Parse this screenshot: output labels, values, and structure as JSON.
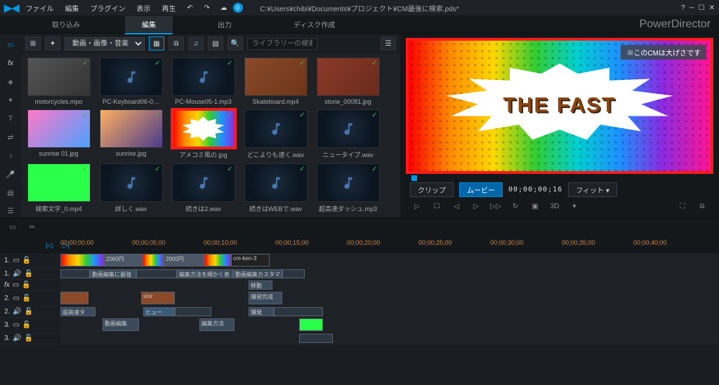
{
  "app": {
    "titlePath": "C:¥Users¥chibi¥Documents¥プロジェクト¥CM最後に検索.pds*",
    "brand": "PowerDirector"
  },
  "menu": {
    "file": "ファイル",
    "edit": "編集",
    "plugin": "プラグイン",
    "view": "表示",
    "play": "再生",
    "badge": "0"
  },
  "tabs": {
    "import": "取り込み",
    "edit": "編集",
    "output": "出力",
    "disc": "ディスク作成"
  },
  "mediaBar": {
    "filter": "動画・画像・音楽",
    "searchPlaceholder": "ライブラリーの検索"
  },
  "media": [
    {
      "label": "motorcycles.mpo",
      "kind": "img",
      "grad": "#555,#333"
    },
    {
      "label": "PC-Keyboard06-0…",
      "kind": "aud"
    },
    {
      "label": "PC-Mouse05-1.mp3",
      "kind": "aud"
    },
    {
      "label": "Skateboard.mp4",
      "kind": "vid",
      "grad": "#8b4a2a,#6a3518"
    },
    {
      "label": "stone_00081.jpg",
      "kind": "img",
      "grad": "#8a3a2a,#6a2a1a"
    },
    {
      "label": "sunrise 01.jpg",
      "kind": "img",
      "grad": "#ff7ac8,#4aa0ff"
    },
    {
      "label": "sunrise.jpg",
      "kind": "img",
      "grad": "#ffb060,#4a3a8a"
    },
    {
      "label": "アメコミ風の.jpg",
      "kind": "burst",
      "highlight": true
    },
    {
      "label": "どこよりも速く.wav",
      "kind": "aud"
    },
    {
      "label": "ニュータイプ.wav",
      "kind": "aud"
    },
    {
      "label": "検索文字_0.mp4",
      "kind": "vid",
      "grad": "#2aff4a,#2aff4a"
    },
    {
      "label": "詳しく.wav",
      "kind": "aud"
    },
    {
      "label": "続きは2.wav",
      "kind": "aud"
    },
    {
      "label": "続きはWEBで.wav",
      "kind": "aud"
    },
    {
      "label": "超高速ダッシュ.mp3",
      "kind": "aud"
    }
  ],
  "preview": {
    "noticeText": "※このCMは大げさです",
    "burstText": "THE FAST",
    "clip": "クリップ",
    "movie": "ムービー",
    "timecode": "00;00;00;16",
    "fit": "フィット",
    "threeD": "3D"
  },
  "ruler": [
    "00;00;00;00",
    "00;00;05;00",
    "00;00;10;00",
    "00;00;15;00",
    "00;00;20;00",
    "00;00;25;00",
    "00;00;30;00",
    "00;00;35;00",
    "00;00;40;00"
  ],
  "tracks": {
    "t1": "1.",
    "t2": "1.",
    "fx": "fx",
    "t3": "2.",
    "t4": "2.",
    "t5": "3.",
    "t6": "3."
  },
  "clips": {
    "c1": "2000円",
    "c2": "2000円",
    "c3": "cm-ken-3",
    "c4": "動画編集に最強",
    "c5": "編集方法を細かく表",
    "c6": "動画編集カスタマ",
    "c7": "移動",
    "c8": "stor",
    "c9": "爆発完成",
    "c10": "超高速タ",
    "c11": "ヒュー",
    "c12": "爆発",
    "c13": "動画編集",
    "c14": "編集方法"
  }
}
